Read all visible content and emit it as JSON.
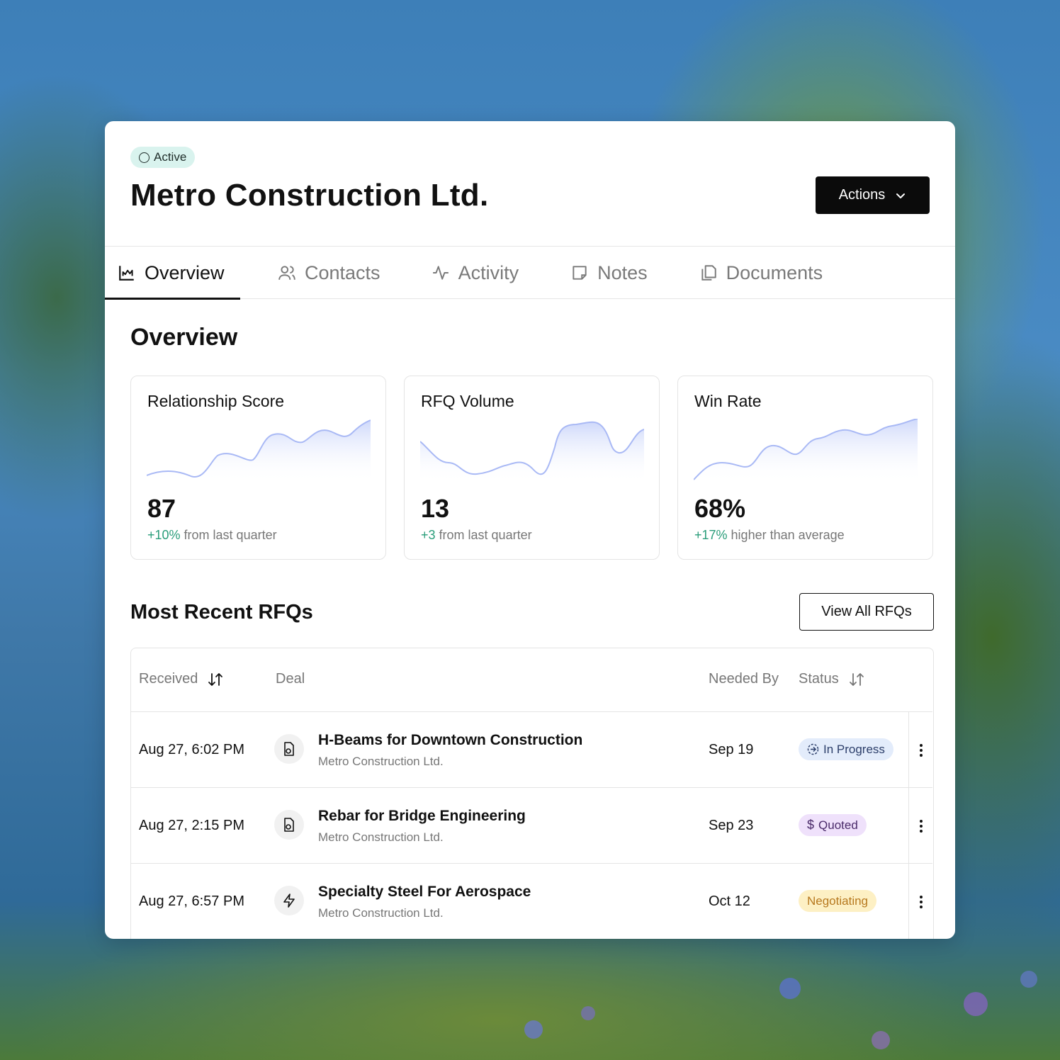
{
  "header": {
    "status_badge": "Active",
    "company_name": "Metro Construction Ltd.",
    "actions_label": "Actions"
  },
  "tabs": [
    {
      "label": "Overview",
      "icon": "chart-icon",
      "active": true
    },
    {
      "label": "Contacts",
      "icon": "users-icon",
      "active": false
    },
    {
      "label": "Activity",
      "icon": "activity-icon",
      "active": false
    },
    {
      "label": "Notes",
      "icon": "note-icon",
      "active": false
    },
    {
      "label": "Documents",
      "icon": "documents-icon",
      "active": false
    }
  ],
  "overview": {
    "title": "Overview",
    "stats": [
      {
        "label": "Relationship Score",
        "value": "87",
        "change_positive": "+10%",
        "change_text": " from last quarter"
      },
      {
        "label": "RFQ Volume",
        "value": "13",
        "change_positive": "+3",
        "change_text": " from last quarter"
      },
      {
        "label": "Win Rate",
        "value": "68%",
        "change_positive": "+17%",
        "change_text": " higher than average"
      }
    ]
  },
  "rfqs": {
    "title": "Most Recent RFQs",
    "view_all_label": "View All RFQs",
    "columns": {
      "received": "Received",
      "deal": "Deal",
      "needed_by": "Needed By",
      "status": "Status"
    },
    "rows": [
      {
        "received": "Aug 27, 6:02 PM",
        "deal_title": "H-Beams for Downtown Construction",
        "deal_company": "Metro Construction Ltd.",
        "needed_by": "Sep 19",
        "status": "In Progress",
        "status_icon": "progress-icon",
        "deal_icon": "document-gear-icon"
      },
      {
        "received": "Aug 27, 2:15 PM",
        "deal_title": "Rebar for Bridge Engineering",
        "deal_company": "Metro Construction Ltd.",
        "needed_by": "Sep 23",
        "status": "Quoted",
        "status_icon": "dollar-icon",
        "deal_icon": "document-gear-icon"
      },
      {
        "received": "Aug 27, 6:57 PM",
        "deal_title": "Specialty Steel For Aerospace",
        "deal_company": "Metro Construction Ltd.",
        "needed_by": "Oct 12",
        "status": "Negotiating",
        "status_icon": "",
        "deal_icon": "lightning-icon"
      }
    ]
  },
  "colors": {
    "accent_dark": "#0b0b0b",
    "positive": "#2a9d7a",
    "active_badge_bg": "#d9f3ee",
    "in_progress_bg": "#e3ecfb",
    "quoted_bg": "#efe1fb",
    "negotiating_bg": "#fdf0c4",
    "negotiating_text": "#b7791f",
    "sparkline": "#a9b9f5"
  }
}
